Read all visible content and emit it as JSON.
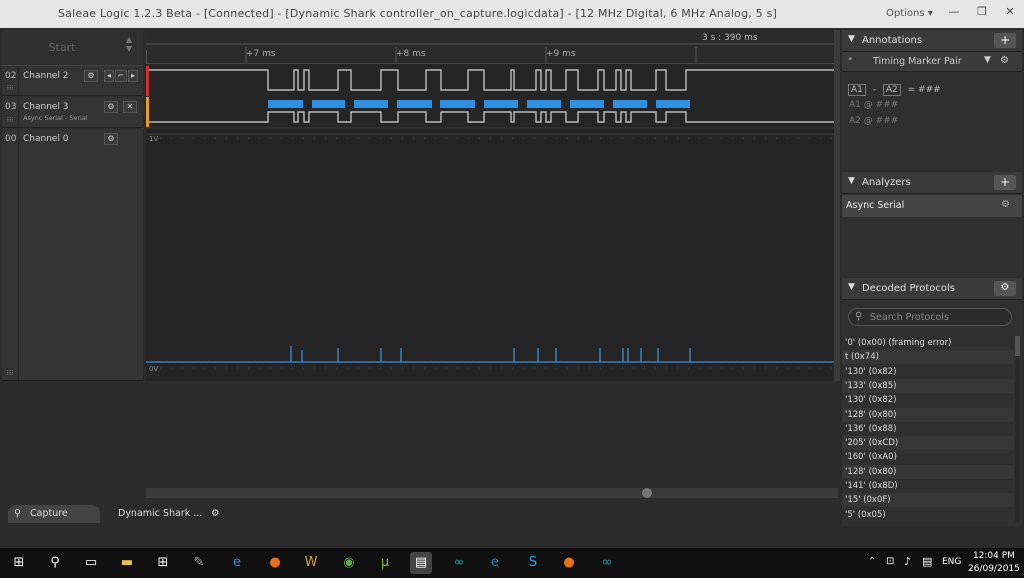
{
  "window": {
    "title": "Saleae Logic 1.2.3 Beta - [Connected] - [Dynamic Shark controller_on_capture.logicdata] - [12 MHz Digital, 6 MHz Analog, 5 s]",
    "options_label": "Options ▾",
    "minimize": "—",
    "restore": "❐",
    "close": "✕"
  },
  "start": {
    "label": "Start"
  },
  "channels": [
    {
      "num": "02",
      "name": "Channel 2"
    },
    {
      "num": "03",
      "name": "Channel 3",
      "sub": "Async Serial - Serial"
    },
    {
      "num": "00",
      "name": "Channel 0"
    }
  ],
  "ruler": {
    "ticks": [
      "+7 ms",
      "+8 ms",
      "+9 ms"
    ],
    "time": "3 s : 390 ms"
  },
  "analog_labels": {
    "top": "1V",
    "bottom": "0V"
  },
  "annotations": {
    "title": "Annotations",
    "add": "+",
    "timing_pair": "Timing Marker Pair",
    "formula_a1": "A1",
    "formula_a2": "A2",
    "formula_eq": "= ###",
    "a1_row": "A1  @  ###",
    "a2_row": "A2  @  ###"
  },
  "analyzers": {
    "title": "Analyzers",
    "add": "+",
    "items": [
      "Async Serial"
    ]
  },
  "decoded": {
    "title": "Decoded Protocols",
    "search_placeholder": "Search Protocols",
    "rows": [
      "'0' (0x00) (framing error)",
      "t (0x74)",
      "'130' (0x82)",
      "'133' (0x85)",
      "'130' (0x82)",
      "'128' (0x80)",
      "'136' (0x88)",
      "'205' (0xCD)",
      "'160' (0xA0)",
      "'128' (0x80)",
      "'141' (0x8D)",
      "'15' (0x0F)",
      "'5' (0x05)"
    ]
  },
  "tabs": {
    "capture": "Capture",
    "file": "Dynamic Shark ..."
  },
  "taskbar": {
    "time": "12:04 PM",
    "date": "26/09/2015",
    "lang": "ENG"
  },
  "colors": {
    "decode_bar": "#2f8fe0",
    "channel2_marker": "#d03030",
    "channel3_marker": "#e39b2a",
    "trace": "#d8d8d8",
    "analog_trace": "#3b8fe0"
  }
}
